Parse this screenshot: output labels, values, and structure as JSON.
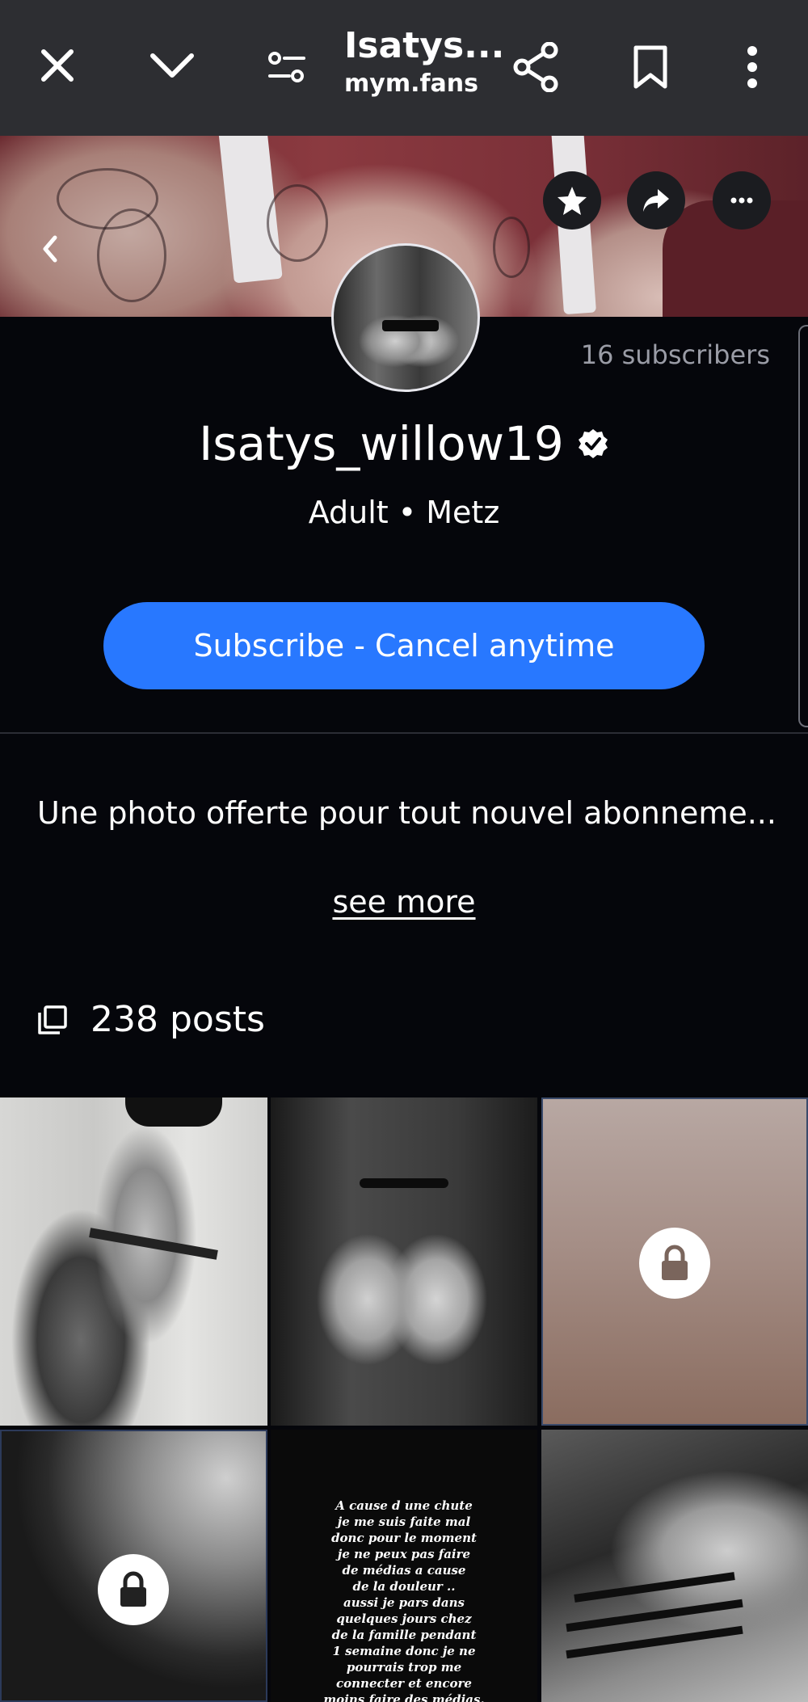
{
  "browser": {
    "title": "Isatys...",
    "url": "mym.fans"
  },
  "profile": {
    "subscribers": "16 subscribers",
    "username": "Isatys_willow19",
    "meta": "Adult • Metz",
    "subscribe_label": "Subscribe - Cancel anytime",
    "bio": "Une photo offerte pour tout nouvel abonneme...",
    "see_more": "see more",
    "posts_count": "238 posts"
  },
  "grid": {
    "notice_lines": [
      "A cause d une chute",
      "je me suis faite mal",
      "donc pour le moment",
      "je ne peux pas faire",
      "de médias a cause",
      "de la douleur ..",
      "aussi je pars dans",
      "quelques jours chez",
      "de la famille pendant",
      "1 semaine donc je ne",
      "pourrais trop me",
      "connecter et encore",
      "moins faire des médias."
    ]
  },
  "colors": {
    "topbar": "#2d2e32",
    "background": "#05060b",
    "accent": "#2878ff",
    "muted_text": "#9a9ca6"
  },
  "icons": [
    "close-icon",
    "chevron-down-icon",
    "tune-icon",
    "share-icon",
    "bookmark-icon",
    "more-vert-icon",
    "star-icon",
    "forward-icon",
    "more-horiz-icon",
    "chevron-left-icon",
    "verified-icon",
    "posts-icon",
    "lock-icon"
  ]
}
